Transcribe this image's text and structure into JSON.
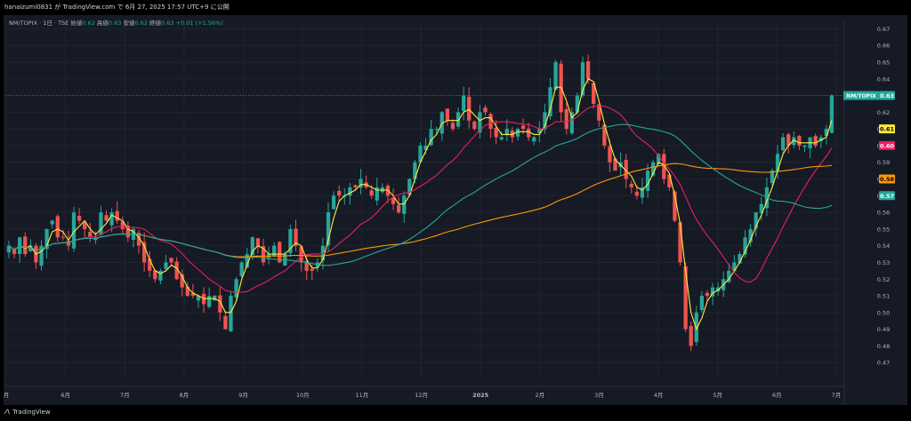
{
  "header": {
    "text": "hanaizumi0831 が TradingView.com で 6月 27, 2025 17:57 UTC+9 に公開"
  },
  "legend": {
    "symbol": "NM/TOPIX · 1日 · TSE",
    "open_label": "始値",
    "open": "0.62",
    "high_label": "高値",
    "high": "0.63",
    "low_label": "安値",
    "low": "0.62",
    "close_label": "終値",
    "close": "0.63",
    "change": "+0.01 (+1.56%)"
  },
  "footer": {
    "logo_text": "TradingView"
  },
  "colors": {
    "background": "#161a25",
    "up_candle": "#26a69a",
    "down_candle": "#ef5350",
    "ma_fast": "#ffeb3b",
    "ma_mid": "#e91e63",
    "ma_slow": "#26a69a",
    "ma_long": "#ff9800",
    "axis_text": "#b2b5be",
    "grid": "#1f2430"
  },
  "chart_data": {
    "type": "candlestick",
    "symbol": "NM/TOPIX",
    "interval": "1日",
    "ylim": [
      0.46,
      0.675
    ],
    "y_ticks": [
      "0.67",
      "0.66",
      "0.65",
      "0.64",
      "0.63",
      "0.62",
      "0.61",
      "0.60",
      "0.59",
      "0.58",
      "0.57",
      "0.56",
      "0.55",
      "0.54",
      "0.53",
      "0.52",
      "0.51",
      "0.50",
      "0.49",
      "0.48",
      "0.47"
    ],
    "x_labels": [
      "月",
      "6月",
      "7月",
      "8月",
      "9月",
      "10月",
      "11月",
      "12月",
      "2025",
      "2月",
      "3月",
      "4月",
      "5月",
      "6月",
      "7月"
    ],
    "price_badges": [
      {
        "label": "NM/TOPIX",
        "value": "0.63"
      },
      {
        "label": "",
        "value": "0.61"
      },
      {
        "label": "",
        "value": "0.60"
      },
      {
        "label": "",
        "value": "0.58"
      },
      {
        "label": "",
        "value": "0.57"
      }
    ],
    "closes": [
      0.54,
      0.535,
      0.545,
      0.535,
      0.54,
      0.53,
      0.54,
      0.55,
      0.555,
      0.545,
      0.545,
      0.54,
      0.56,
      0.555,
      0.55,
      0.545,
      0.545,
      0.56,
      0.555,
      0.56,
      0.555,
      0.55,
      0.545,
      0.55,
      0.54,
      0.53,
      0.525,
      0.52,
      0.525,
      0.53,
      0.53,
      0.52,
      0.515,
      0.51,
      0.51,
      0.51,
      0.505,
      0.51,
      0.51,
      0.5,
      0.49,
      0.51,
      0.52,
      0.53,
      0.535,
      0.545,
      0.54,
      0.53,
      0.535,
      0.54,
      0.53,
      0.535,
      0.55,
      0.54,
      0.53,
      0.525,
      0.525,
      0.53,
      0.54,
      0.56,
      0.57,
      0.57,
      0.57,
      0.575,
      0.575,
      0.58,
      0.575,
      0.57,
      0.575,
      0.575,
      0.57,
      0.565,
      0.56,
      0.57,
      0.58,
      0.59,
      0.6,
      0.6,
      0.61,
      0.61,
      0.62,
      0.615,
      0.61,
      0.62,
      0.63,
      0.615,
      0.61,
      0.62,
      0.62,
      0.61,
      0.605,
      0.605,
      0.61,
      0.605,
      0.61,
      0.61,
      0.605,
      0.605,
      0.61,
      0.62,
      0.635,
      0.65,
      0.62,
      0.61,
      0.62,
      0.63,
      0.65,
      0.64,
      0.625,
      0.615,
      0.6,
      0.59,
      0.585,
      0.59,
      0.58,
      0.575,
      0.57,
      0.575,
      0.585,
      0.59,
      0.595,
      0.58,
      0.575,
      0.555,
      0.53,
      0.49,
      0.48,
      0.5,
      0.51,
      0.51,
      0.515,
      0.515,
      0.52,
      0.525,
      0.53,
      0.535,
      0.545,
      0.55,
      0.56,
      0.565,
      0.575,
      0.585,
      0.595,
      0.605,
      0.6,
      0.605,
      0.6,
      0.6,
      0.605,
      0.6,
      0.605,
      0.61,
      0.63
    ],
    "moving_averages": [
      {
        "period_hint": "fast",
        "color_key": "ma_fast",
        "last": 0.61
      },
      {
        "period_hint": "mid",
        "color_key": "ma_mid",
        "last": 0.6
      },
      {
        "period_hint": "long",
        "color_key": "ma_long",
        "last": 0.58
      },
      {
        "period_hint": "slow",
        "color_key": "ma_slow",
        "last": 0.57
      }
    ],
    "grid": true
  }
}
